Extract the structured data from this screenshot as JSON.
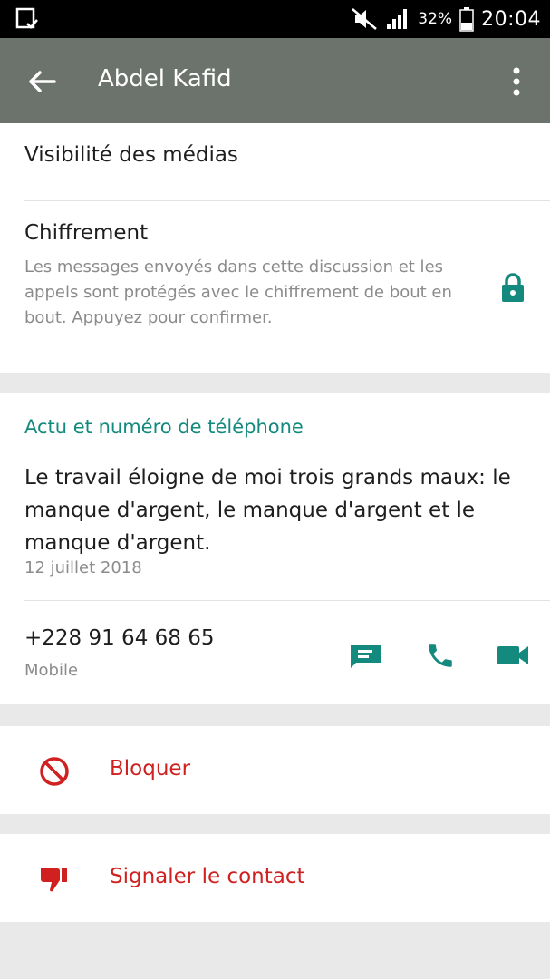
{
  "status_bar": {
    "battery": "32%",
    "time": "20:04"
  },
  "app_bar": {
    "title": "Abdel Kafid"
  },
  "media": {
    "label": "Visibilité des médias"
  },
  "encryption": {
    "title": "Chiffrement",
    "description": "Les messages envoyés dans cette discussion et les appels sont protégés avec le chiffrement de bout en bout. Appuyez pour confirmer."
  },
  "about": {
    "section_title": "Actu et numéro de téléphone",
    "text": "Le travail éloigne de moi trois grands maux: le manque d'argent, le manque d'argent et le manque d'argent.",
    "date": "12 juillet 2018"
  },
  "phone": {
    "number": "+228 91 64 68 65",
    "type": "Mobile"
  },
  "actions": {
    "block": "Bloquer",
    "report": "Signaler le contact"
  },
  "colors": {
    "accent": "#138a7d",
    "danger": "#d02020",
    "app_bar": "#6c736c"
  }
}
